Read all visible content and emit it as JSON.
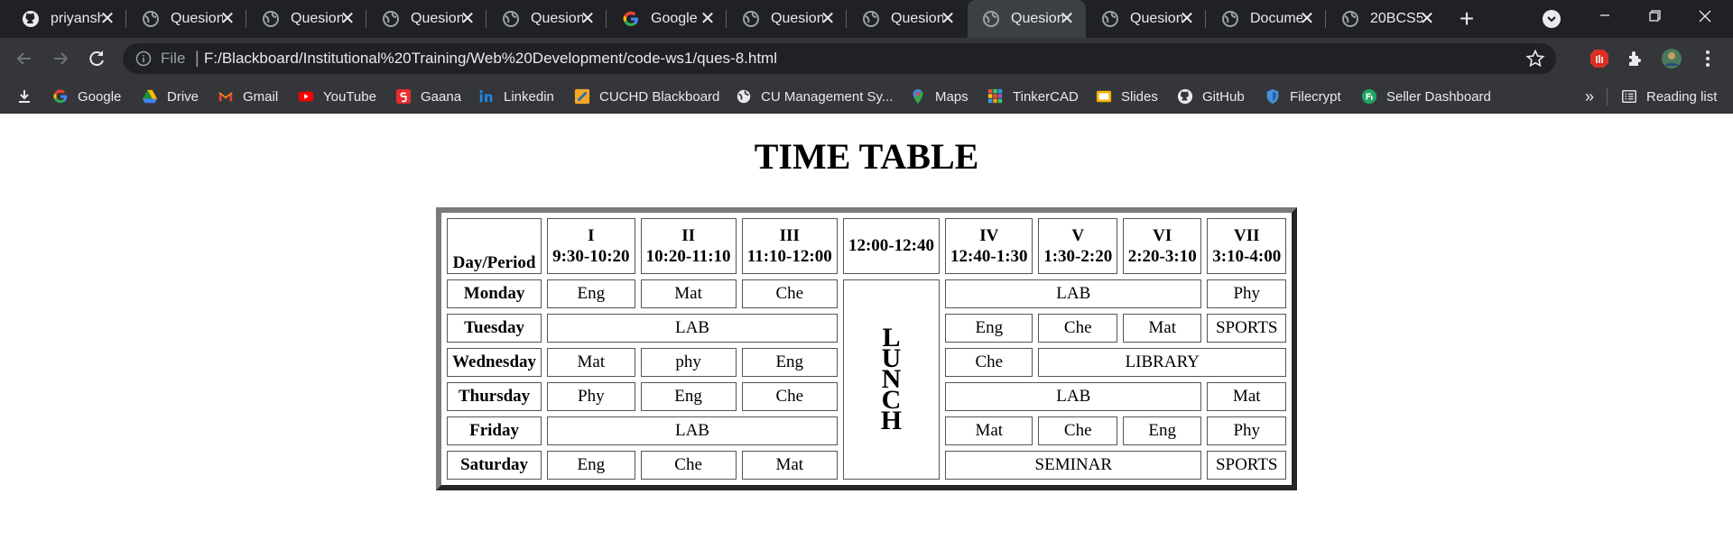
{
  "browser": {
    "tabs": [
      {
        "title": "priyansh",
        "icon": "github-icon",
        "active": false
      },
      {
        "title": "Quesion",
        "icon": "globe-icon",
        "active": false
      },
      {
        "title": "Quesion",
        "icon": "globe-icon",
        "active": false
      },
      {
        "title": "Quesion",
        "icon": "globe-icon",
        "active": false
      },
      {
        "title": "Quesion",
        "icon": "globe-icon",
        "active": false
      },
      {
        "title": "Google",
        "icon": "google-icon",
        "active": false
      },
      {
        "title": "Quesion",
        "icon": "globe-icon",
        "active": false
      },
      {
        "title": "Quesion",
        "icon": "globe-icon",
        "active": false
      },
      {
        "title": "Quesion",
        "icon": "globe-icon",
        "active": true
      },
      {
        "title": "Quesion",
        "icon": "globe-icon",
        "active": false
      },
      {
        "title": "Docume",
        "icon": "globe-icon",
        "active": false
      },
      {
        "title": "20BCS5",
        "icon": "globe-icon",
        "active": false
      }
    ],
    "close_glyph": "✕",
    "new_tab_glyph": "+",
    "address": {
      "scheme_label": "File",
      "separator": "|",
      "url": "F:/Blackboard/Institutional%20Training/Web%20Development/code-ws1/ques-8.html"
    },
    "bookmarks": [
      {
        "label": "Google",
        "icon": "google-icon"
      },
      {
        "label": "Drive",
        "icon": "drive-icon"
      },
      {
        "label": "Gmail",
        "icon": "gmail-icon"
      },
      {
        "label": "YouTube",
        "icon": "youtube-icon"
      },
      {
        "label": "Gaana",
        "icon": "gaana-icon"
      },
      {
        "label": "Linkedin",
        "icon": "linkedin-icon"
      },
      {
        "label": "CUCHD Blackboard",
        "icon": "blackboard-icon"
      },
      {
        "label": "CU Management Sy...",
        "icon": "globe-icon"
      },
      {
        "label": "Maps",
        "icon": "maps-icon"
      },
      {
        "label": "TinkerCAD",
        "icon": "tinkercad-icon"
      },
      {
        "label": "Slides",
        "icon": "slides-icon"
      },
      {
        "label": "GitHub",
        "icon": "github-icon"
      },
      {
        "label": "Filecrypt",
        "icon": "filecrypt-icon"
      },
      {
        "label": "Seller Dashboard",
        "icon": "seller-icon"
      }
    ],
    "bookmarks_overflow": "»",
    "reading_list_label": "Reading list",
    "colors": {
      "frame": "#202124",
      "toolbar": "#35363a",
      "omnibox": "#202124",
      "text": "#e8eaed"
    }
  },
  "page": {
    "heading": "TIME TABLE",
    "table": {
      "corner_label": "Day/Period",
      "periods": [
        {
          "num": "I",
          "time": "9:30-10:20"
        },
        {
          "num": "II",
          "time": "10:20-11:10"
        },
        {
          "num": "III",
          "time": "11:10-12:00"
        },
        {
          "num": "",
          "time": "12:00-12:40"
        },
        {
          "num": "IV",
          "time": "12:40-1:30"
        },
        {
          "num": "V",
          "time": "1:30-2:20"
        },
        {
          "num": "VI",
          "time": "2:20-3:10"
        },
        {
          "num": "VII",
          "time": "3:10-4:00"
        }
      ],
      "lunch_letters": [
        "L",
        "U",
        "N",
        "C",
        "H"
      ],
      "days": {
        "monday": {
          "day": "Monday",
          "c1": "Eng",
          "c2": "Mat",
          "c3": "Che",
          "lab": "LAB",
          "c7": "Phy"
        },
        "tuesday": {
          "day": "Tuesday",
          "lab": "LAB",
          "c4": "Eng",
          "c5": "Che",
          "c6": "Mat",
          "c7": "SPORTS"
        },
        "wednesday": {
          "day": "Wednesday",
          "c1": "Mat",
          "c2": "phy",
          "c3": "Eng",
          "c4": "Che",
          "library": "LIBRARY"
        },
        "thursday": {
          "day": "Thursday",
          "c1": "Phy",
          "c2": "Eng",
          "c3": "Che",
          "lab": "LAB",
          "c7": "Mat"
        },
        "friday": {
          "day": "Friday",
          "lab": "LAB",
          "c4": "Mat",
          "c5": "Che",
          "c6": "Eng",
          "c7": "Phy"
        },
        "saturday": {
          "day": "Saturday",
          "c1": "Eng",
          "c2": "Che",
          "c3": "Mat",
          "seminar": "SEMINAR",
          "c7": "SPORTS"
        }
      }
    }
  }
}
